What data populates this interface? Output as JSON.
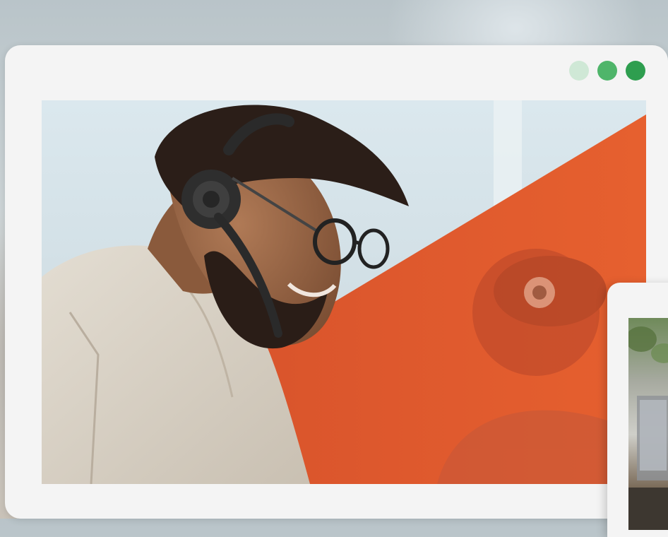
{
  "window": {
    "controls": [
      {
        "name": "window-dot-light",
        "color": "#cfe8d6"
      },
      {
        "name": "window-dot-medium",
        "color": "#4fb56a"
      },
      {
        "name": "window-dot-dark",
        "color": "#2e9e4f"
      }
    ]
  },
  "hero": {
    "accent_color": "#e4572e",
    "subject": "photo-call-center-agent-with-headset"
  },
  "second_window": {
    "subject": "photo-thumbnail"
  }
}
